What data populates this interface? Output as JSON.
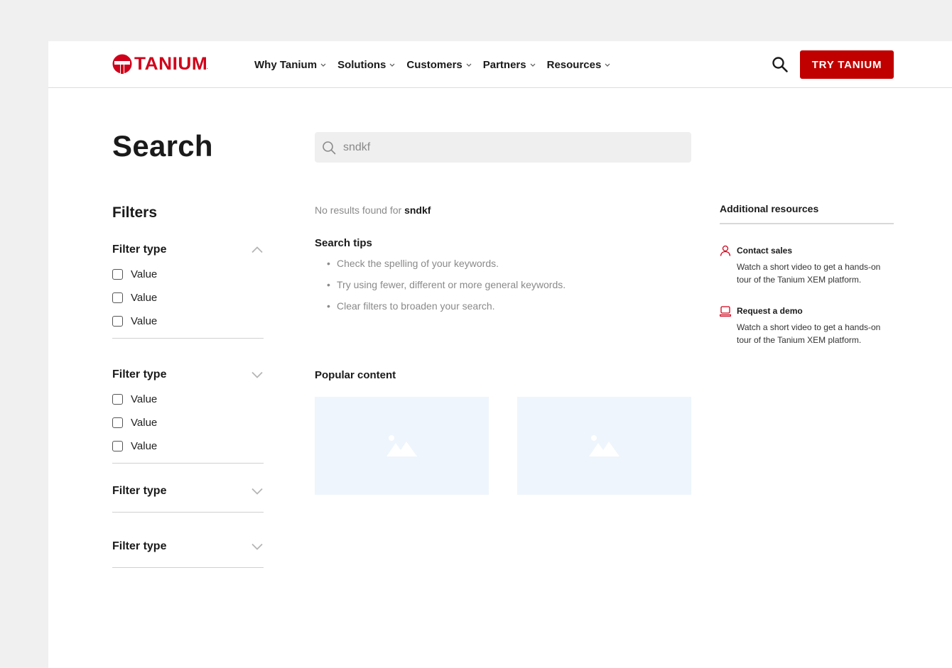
{
  "brand": {
    "name": "TANIUM",
    "mark": ".",
    "accent": "#d0021b",
    "button_color": "#c00000"
  },
  "nav": {
    "items": [
      {
        "label": "Why Tanium"
      },
      {
        "label": "Solutions"
      },
      {
        "label": "Customers"
      },
      {
        "label": "Partners"
      },
      {
        "label": "Resources"
      }
    ]
  },
  "header": {
    "search_icon": "search-icon",
    "cta_label": "TRY TANIUM"
  },
  "page": {
    "title": "Search"
  },
  "search": {
    "value": "sndkf",
    "icon": "search-icon"
  },
  "filters": {
    "title": "Filters",
    "groups": [
      {
        "label": "Filter type",
        "expanded": true,
        "options": [
          "Value",
          "Value",
          "Value"
        ]
      },
      {
        "label": "Filter type",
        "expanded": true,
        "options": [
          "Value",
          "Value",
          "Value"
        ]
      },
      {
        "label": "Filter type",
        "expanded": false,
        "options": []
      },
      {
        "label": "Filter type",
        "expanded": false,
        "options": []
      }
    ]
  },
  "results": {
    "no_results_prefix": "No results found for",
    "query": "sndkf",
    "tips_title": "Search tips",
    "tips": [
      "Check the spelling of your keywords.",
      "Try using fewer, different or more general keywords.",
      "Clear filters to broaden your search."
    ],
    "popular_title": "Popular content",
    "popular_cards": [
      {
        "icon": "image-placeholder-icon"
      },
      {
        "icon": "image-placeholder-icon"
      }
    ]
  },
  "resources": {
    "title": "Additional resources",
    "items": [
      {
        "label": "Contact sales",
        "icon": "user-icon",
        "description": "Watch a short video to get a hands-on tour of the Tanium XEM platform."
      },
      {
        "label": "Request a demo",
        "icon": "laptop-icon",
        "description": "Watch a short video to get a hands-on tour of the Tanium XEM platform."
      }
    ]
  }
}
